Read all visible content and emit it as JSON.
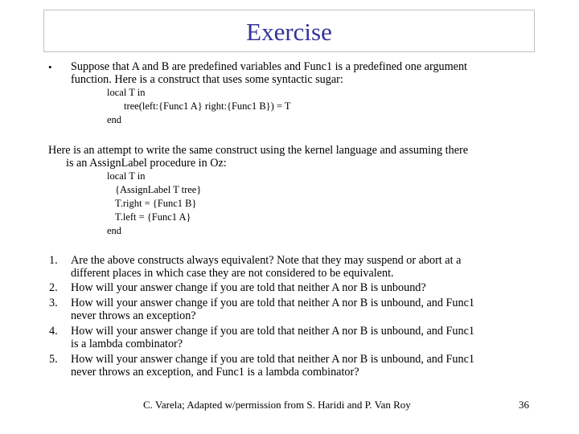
{
  "slide": {
    "title": "Exercise",
    "title_color": "#333399",
    "intro_bullet": {
      "marker": "•",
      "lines": [
        "Suppose that A and B are predefined variables and Func1 is a predefined one argument",
        "function. Here is a construct that uses some syntactic sugar:"
      ]
    },
    "code1": [
      "local T in",
      "tree(left:{Func1 A} right:{Func1 B}) = T",
      "end"
    ],
    "paragraph2": {
      "lines": [
        "Here is an attempt to write the same construct using the kernel language and assuming there",
        "is an AssignLabel procedure in Oz:"
      ]
    },
    "code2": [
      "local T in",
      "{AssignLabel T tree}",
      "T.right = {Func1 B}",
      "T.left = {Func1 A}",
      "end"
    ],
    "questions": [
      {
        "number": "1.",
        "lines": [
          "Are the above constructs always equivalent? Note that they may suspend or abort at a",
          "different places in which case they are not considered to be equivalent."
        ]
      },
      {
        "number": "2.",
        "lines": [
          "How will your answer change if you are told that neither A nor B is unbound?"
        ]
      },
      {
        "number": "3.",
        "lines": [
          "How will your answer change if you are told that neither A nor B is unbound, and Func1",
          "never throws an exception?"
        ]
      },
      {
        "number": "4.",
        "lines": [
          "How will your answer change if you are told that neither A nor B is unbound, and Func1",
          "is a lambda combinator?"
        ]
      },
      {
        "number": "5.",
        "lines": [
          "How will your answer change if you are told that neither A nor B is unbound, and Func1",
          "never throws an exception, and Func1 is a lambda combinator?"
        ]
      }
    ],
    "footer": {
      "credit": "C. Varela; Adapted w/permission from S. Haridi and P. Van Roy",
      "page_number": "36"
    }
  }
}
